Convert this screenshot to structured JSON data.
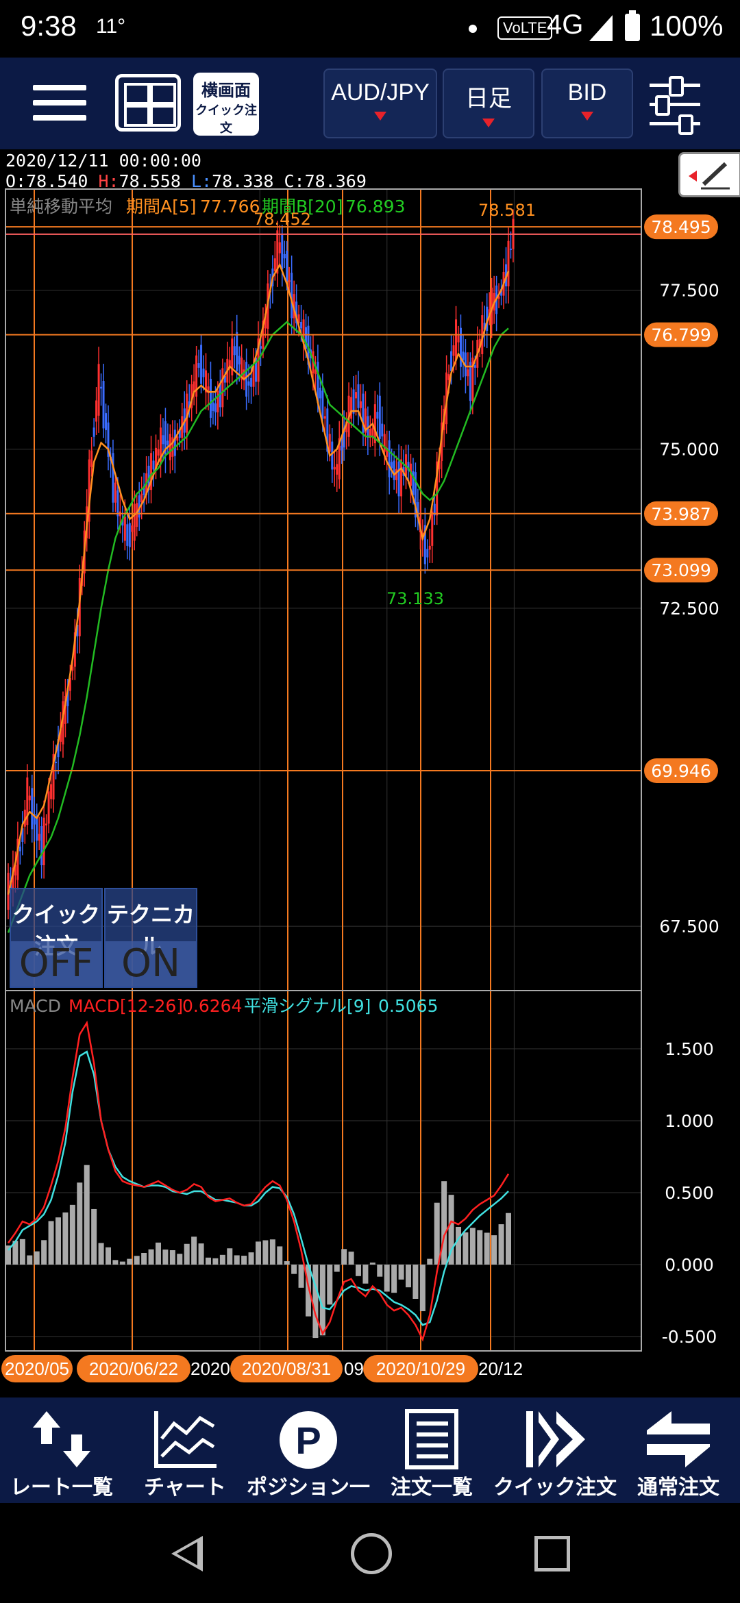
{
  "status_bar": {
    "time": "9:38",
    "temp": "11°",
    "volte": "VoLTE",
    "network": "4G",
    "battery": "100%"
  },
  "app_bar": {
    "landscape_line1": "横画面",
    "landscape_line2": "クイック注文",
    "pair": "AUD/JPY",
    "timeframe": "日足",
    "price_side": "BID"
  },
  "ohlc": {
    "datetime": "2020/12/11 00:00:00",
    "open_label": "O:",
    "open": "78.540",
    "high_label": "H:",
    "high": "78.558",
    "low_label": "L:",
    "low": "78.338",
    "close_label": "C:",
    "close": "78.369"
  },
  "toggles": {
    "quick_order_label": "クイック注文",
    "quick_order_value": "OFF",
    "technical_label": "テクニカル",
    "technical_value": "ON"
  },
  "date_axis": [
    {
      "text": "2020/05",
      "type": "pill"
    },
    {
      "text": "2020/06/22",
      "type": "pill"
    },
    {
      "text": "2020",
      "type": "plain"
    },
    {
      "text": "2020/08/31",
      "type": "pill"
    },
    {
      "text": "09",
      "type": "plain"
    },
    {
      "text": "2020/10/29",
      "type": "pill"
    },
    {
      "text": "20/12",
      "type": "plain"
    }
  ],
  "tabs": [
    {
      "label": "レート一覧",
      "icon": "rate-list-icon"
    },
    {
      "label": "チャート",
      "icon": "chart-icon"
    },
    {
      "label": "ポジション一覧",
      "icon": "position-icon"
    },
    {
      "label": "注文一覧",
      "icon": "order-list-icon"
    },
    {
      "label": "クイック注文",
      "icon": "quick-order-icon"
    },
    {
      "label": "通常注文",
      "icon": "normal-order-icon"
    }
  ],
  "colors": {
    "accent": "#f47920",
    "app_bg": "#0c1a45",
    "ma_short": "#ff9020",
    "ma_long": "#22bb22",
    "macd": "#ff2020",
    "signal": "#40e0e0",
    "bull": "#ff3030",
    "bear": "#3a6cff"
  },
  "chart_data": [
    {
      "type": "candlestick",
      "name": "price",
      "indicator_title": "単純移動平均",
      "ma_a_label": "期間A[5]",
      "ma_a_value": "77.766",
      "ma_b_label": "期間B[20]",
      "ma_b_value": "76.893",
      "y_ticks": [
        "77.500",
        "75.000",
        "72.500",
        "67.500"
      ],
      "ylim": [
        66.5,
        79.1
      ],
      "marked_levels": [
        "78.495",
        "76.799",
        "73.987",
        "73.099",
        "69.946"
      ],
      "annotations": {
        "high_a": "78.452",
        "high_b": "78.581",
        "low": "73.133"
      },
      "close_path": [
        68.3,
        68.8,
        69.6,
        69.1,
        68.7,
        69.5,
        70.2,
        70.8,
        71.4,
        72.3,
        73.6,
        75.1,
        76.1,
        75.3,
        74.4,
        73.9,
        73.6,
        73.9,
        74.3,
        74.6,
        74.9,
        75.2,
        75.0,
        75.2,
        75.5,
        75.9,
        76.4,
        76.0,
        75.6,
        75.9,
        76.3,
        76.6,
        76.2,
        76.0,
        76.3,
        76.9,
        77.6,
        78.2,
        78.0,
        77.3,
        77.0,
        76.7,
        76.3,
        75.8,
        75.2,
        74.6,
        75.1,
        75.6,
        75.9,
        75.5,
        75.2,
        75.6,
        75.0,
        74.7,
        74.5,
        74.8,
        74.4,
        73.7,
        73.3,
        74.2,
        75.3,
        76.3,
        76.8,
        76.4,
        76.0,
        76.6,
        77.0,
        77.3,
        77.4,
        77.8,
        78.5
      ],
      "ma_a": [
        68.0,
        68.5,
        69.1,
        69.3,
        69.2,
        69.4,
        69.9,
        70.4,
        71.0,
        71.7,
        72.6,
        73.8,
        74.8,
        75.1,
        75.0,
        74.6,
        74.2,
        73.9,
        74.0,
        74.2,
        74.5,
        74.8,
        75.0,
        75.1,
        75.3,
        75.5,
        75.9,
        76.0,
        75.9,
        75.9,
        76.1,
        76.3,
        76.2,
        76.1,
        76.2,
        76.6,
        77.1,
        77.7,
        77.9,
        77.6,
        77.2,
        76.8,
        76.4,
        75.9,
        75.4,
        74.9,
        75.0,
        75.3,
        75.6,
        75.6,
        75.3,
        75.4,
        75.1,
        74.8,
        74.6,
        74.7,
        74.5,
        74.1,
        73.6,
        73.9,
        74.6,
        75.5,
        76.2,
        76.5,
        76.3,
        76.3,
        76.6,
        77.0,
        77.3,
        77.5,
        77.8
      ],
      "ma_b": [
        67.4,
        67.7,
        68.0,
        68.3,
        68.5,
        68.7,
        68.9,
        69.2,
        69.6,
        70.0,
        70.5,
        71.1,
        71.8,
        72.5,
        73.1,
        73.6,
        73.9,
        74.1,
        74.3,
        74.4,
        74.6,
        74.7,
        74.9,
        75.0,
        75.1,
        75.2,
        75.4,
        75.6,
        75.7,
        75.8,
        75.9,
        76.0,
        76.1,
        76.2,
        76.3,
        76.4,
        76.6,
        76.8,
        76.9,
        77.0,
        76.9,
        76.8,
        76.6,
        76.3,
        76.0,
        75.7,
        75.6,
        75.5,
        75.4,
        75.3,
        75.2,
        75.2,
        75.1,
        75.0,
        74.9,
        74.8,
        74.7,
        74.5,
        74.3,
        74.2,
        74.3,
        74.5,
        74.8,
        75.1,
        75.4,
        75.7,
        76.0,
        76.3,
        76.6,
        76.8,
        76.9
      ]
    },
    {
      "type": "line",
      "name": "MACD",
      "title": "MACD",
      "macd_label": "MACD[12-26]",
      "macd_value": "0.6264",
      "signal_label": "平滑シグナル[9]",
      "signal_value": "0.5065",
      "y_ticks": [
        "1.500",
        "1.000",
        "0.500",
        "0.000",
        "-0.500"
      ],
      "ylim": [
        -0.6,
        1.9
      ],
      "macd": [
        0.15,
        0.22,
        0.3,
        0.28,
        0.32,
        0.4,
        0.55,
        0.72,
        0.95,
        1.3,
        1.6,
        1.68,
        1.4,
        1.0,
        0.8,
        0.65,
        0.58,
        0.56,
        0.55,
        0.54,
        0.56,
        0.58,
        0.55,
        0.52,
        0.5,
        0.52,
        0.56,
        0.54,
        0.47,
        0.44,
        0.45,
        0.46,
        0.43,
        0.41,
        0.42,
        0.48,
        0.54,
        0.58,
        0.55,
        0.45,
        0.3,
        0.1,
        -0.15,
        -0.35,
        -0.48,
        -0.4,
        -0.25,
        -0.12,
        -0.1,
        -0.18,
        -0.22,
        -0.15,
        -0.2,
        -0.28,
        -0.32,
        -0.3,
        -0.35,
        -0.42,
        -0.52,
        -0.35,
        -0.05,
        0.2,
        0.3,
        0.28,
        0.32,
        0.38,
        0.42,
        0.45,
        0.48,
        0.55,
        0.63
      ],
      "signal": [
        0.1,
        0.16,
        0.24,
        0.27,
        0.3,
        0.35,
        0.45,
        0.62,
        0.85,
        1.2,
        1.45,
        1.48,
        1.32,
        1.0,
        0.8,
        0.68,
        0.61,
        0.58,
        0.56,
        0.54,
        0.55,
        0.55,
        0.54,
        0.51,
        0.5,
        0.49,
        0.51,
        0.51,
        0.48,
        0.45,
        0.45,
        0.44,
        0.43,
        0.41,
        0.41,
        0.44,
        0.5,
        0.54,
        0.53,
        0.47,
        0.35,
        0.18,
        0.0,
        -0.15,
        -0.3,
        -0.31,
        -0.25,
        -0.18,
        -0.15,
        -0.16,
        -0.18,
        -0.17,
        -0.18,
        -0.22,
        -0.26,
        -0.28,
        -0.31,
        -0.35,
        -0.42,
        -0.4,
        -0.25,
        -0.05,
        0.1,
        0.18,
        0.24,
        0.29,
        0.34,
        0.38,
        0.42,
        0.46,
        0.51
      ]
    }
  ]
}
